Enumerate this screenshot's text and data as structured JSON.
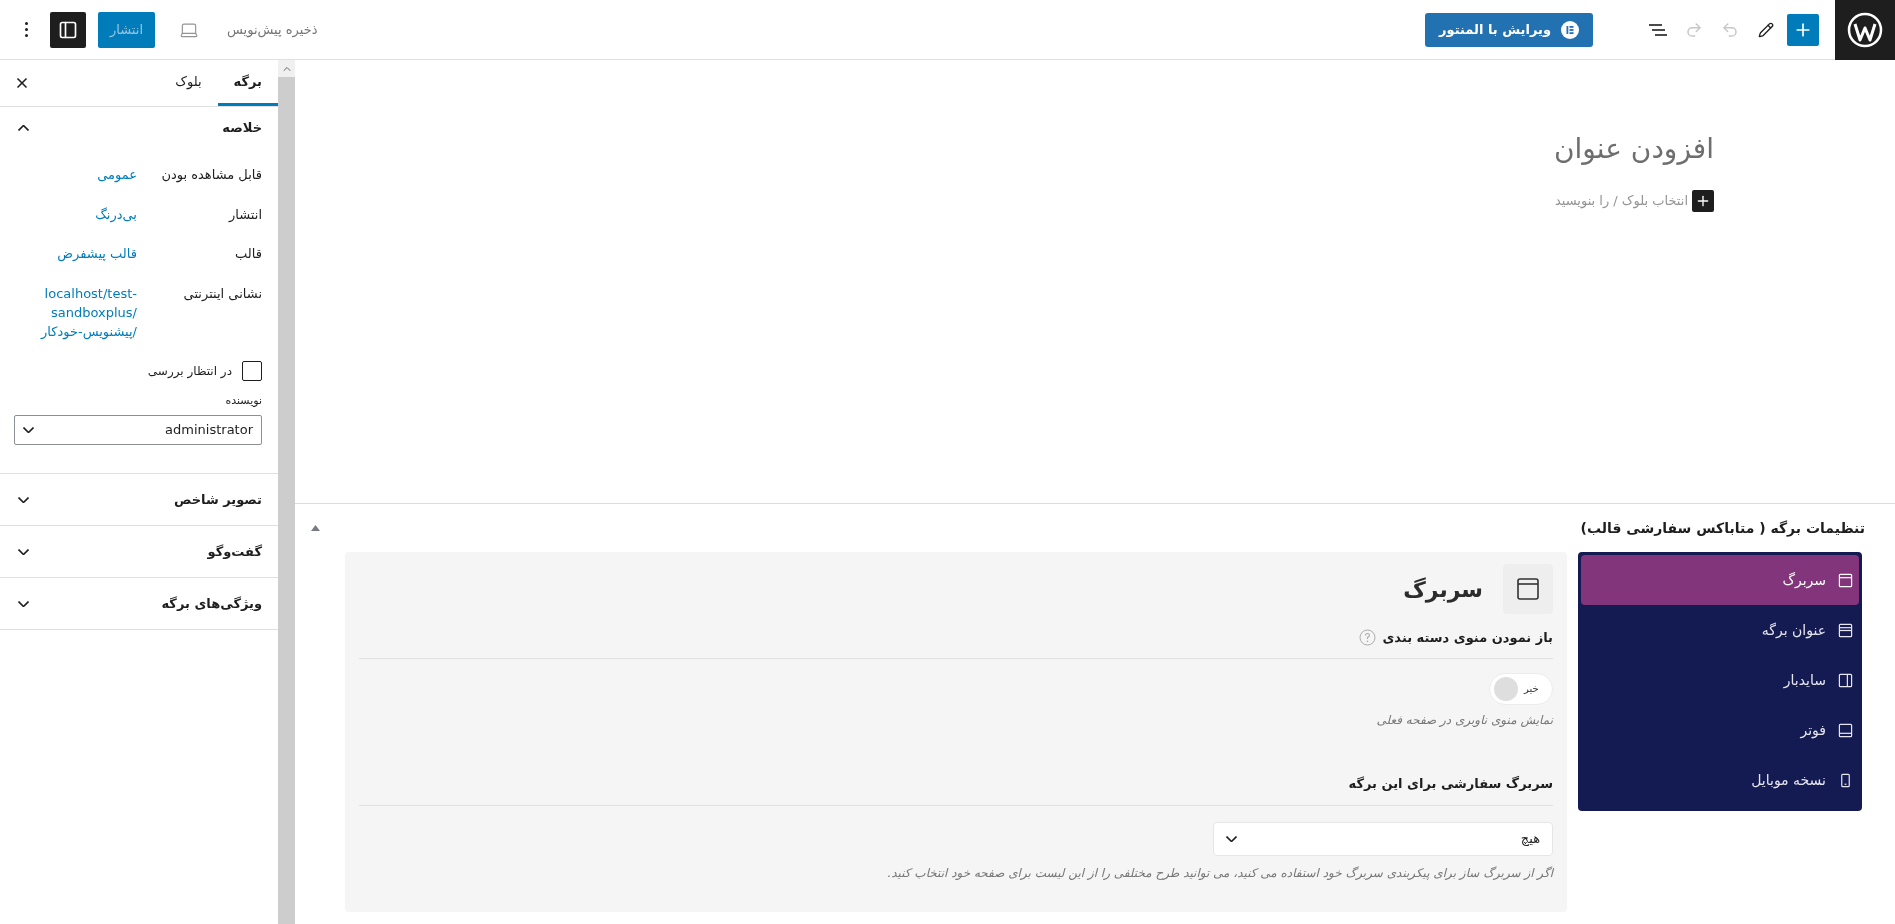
{
  "topbar": {
    "edit_button": "ویرایش با المنتور",
    "undo": {
      "disabled": true
    },
    "redo": {
      "disabled": true
    },
    "save_draft": "ذخیره پیش‌نویس",
    "publish": "انتشار"
  },
  "sidebar": {
    "tabs": [
      {
        "label": "برگه",
        "selected": true
      },
      {
        "label": "بلوک",
        "selected": false
      }
    ],
    "summary": {
      "title": "خلاصه",
      "expanded": true,
      "rows": [
        {
          "label": "قابل مشاهده بودن",
          "value": "عمومی"
        },
        {
          "label": "انتشار",
          "value": "بی‌درنگ"
        },
        {
          "label": "قالب",
          "value": "قالب پیشفرض"
        },
        {
          "label": "نشانی اینترنتی",
          "value": "localhost/test-sandboxplus/پیشنویس-خودکار/"
        }
      ],
      "pending_review": {
        "label": "در انتظار بررسی",
        "checked": false
      },
      "author": {
        "label": "نویسنده",
        "value": "administrator"
      }
    },
    "panels": [
      {
        "title": "تصویر شاخص",
        "expanded": false
      },
      {
        "title": "گفت‌وگو",
        "expanded": false
      },
      {
        "title": "ویژگی‌های برگه",
        "expanded": false
      }
    ]
  },
  "editor": {
    "title_placeholder": "افزودن عنوان",
    "block_placeholder": "انتخاب بلوک / را بنویسید"
  },
  "metabox": {
    "title": "تنظیمات برگه ( متاباکس سفارشی قالب)",
    "expanded": true,
    "nav": [
      {
        "label": "سربرگ",
        "kind": "header",
        "selected": true
      },
      {
        "label": "عنوان برگه",
        "kind": "title",
        "selected": false
      },
      {
        "label": "سایدبار",
        "kind": "sidebar",
        "selected": false
      },
      {
        "label": "فوتر",
        "kind": "footer",
        "selected": false
      },
      {
        "label": "نسخه موبایل",
        "kind": "mobile",
        "selected": false
      }
    ],
    "section": {
      "title": "سربرگ",
      "fields": [
        {
          "kind": "toggle",
          "label": "باز نمودن منوی دسته بندی",
          "toggle_label": "خیر",
          "on": false,
          "description": "نمایش منوی ناوبری در صفحه فعلی"
        },
        {
          "kind": "select",
          "label": "سربرگ سفارشی برای این برگه",
          "value": "هیچ",
          "description": "اگر از سربرگ ساز برای پیکربندی سربرگ خود استفاده می کنید، می توانید طرح مختلفی را از این لیست برای صفحه خود انتخاب کنید."
        }
      ]
    }
  }
}
